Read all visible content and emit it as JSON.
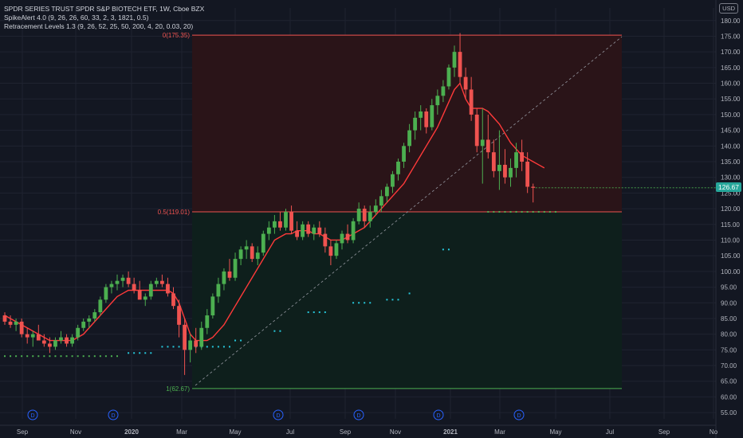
{
  "header": {
    "title": "SPDR SERIES TRUST SPDR S&P BIOTECH ETF, 1W, Cboe BZX",
    "indicator_1": "SpikeAlert 4.0 (9, 26, 26, 60, 33, 2, 3, 1821, 0.5)",
    "indicator_2": "Retracement Levels 1.3 (9, 26, 52, 25, 50, 200, 4, 20, 0.03, 20)",
    "currency": "USD"
  },
  "chart_data": {
    "type": "candlestick",
    "x_ticks": [
      "Sep",
      "Nov",
      "2020",
      "Mar",
      "May",
      "Jul",
      "Sep",
      "Nov",
      "2021",
      "Mar",
      "May",
      "Jul",
      "Sep",
      "No"
    ],
    "y_ticks": [
      55,
      60,
      65,
      70,
      75,
      80,
      85,
      90,
      95,
      100,
      105,
      110,
      115,
      120,
      125,
      130,
      135,
      140,
      145,
      150,
      155,
      160,
      165,
      170,
      175,
      180
    ],
    "ylim": [
      53,
      184
    ],
    "last_price_label": "126.67",
    "last_price": 126.67,
    "retracement": [
      {
        "label": "0(175.35)",
        "value": 175.35,
        "color": "#ef5350"
      },
      {
        "label": "0.5(119.01)",
        "value": 119.01,
        "color": "#ef5350"
      },
      {
        "label": "1(62.67)",
        "value": 62.67,
        "color": "#4caf50"
      }
    ],
    "candles": [
      [
        86,
        87,
        83,
        84
      ],
      [
        84,
        86,
        82,
        83
      ],
      [
        83,
        85,
        81,
        84
      ],
      [
        84,
        85,
        79,
        80
      ],
      [
        80,
        82,
        77,
        79
      ],
      [
        79,
        81,
        76,
        80
      ],
      [
        80,
        83,
        79,
        78
      ],
      [
        78,
        80,
        76,
        77
      ],
      [
        77,
        79,
        74,
        76
      ],
      [
        76,
        79,
        75,
        78
      ],
      [
        78,
        81,
        77,
        79
      ],
      [
        79,
        80,
        76,
        77
      ],
      [
        77,
        80,
        76,
        79
      ],
      [
        79,
        83,
        78,
        82
      ],
      [
        82,
        85,
        81,
        84
      ],
      [
        84,
        86,
        82,
        85
      ],
      [
        85,
        88,
        84,
        87
      ],
      [
        87,
        92,
        86,
        91
      ],
      [
        91,
        96,
        90,
        95
      ],
      [
        95,
        97,
        93,
        96
      ],
      [
        96,
        99,
        94,
        97
      ],
      [
        97,
        99,
        95,
        98
      ],
      [
        98,
        100,
        95,
        96
      ],
      [
        96,
        98,
        93,
        94
      ],
      [
        94,
        97,
        92,
        91
      ],
      [
        91,
        93,
        89,
        92
      ],
      [
        92,
        97,
        91,
        96
      ],
      [
        96,
        98,
        95,
        97
      ],
      [
        97,
        99,
        95,
        96
      ],
      [
        96,
        98,
        92,
        93
      ],
      [
        93,
        95,
        88,
        89
      ],
      [
        89,
        91,
        79,
        83
      ],
      [
        83,
        85,
        67,
        75
      ],
      [
        75,
        80,
        71,
        78
      ],
      [
        78,
        82,
        74,
        76
      ],
      [
        76,
        84,
        75,
        82
      ],
      [
        82,
        88,
        80,
        86
      ],
      [
        86,
        93,
        85,
        92
      ],
      [
        92,
        98,
        90,
        96
      ],
      [
        96,
        101,
        94,
        100
      ],
      [
        100,
        104,
        97,
        98
      ],
      [
        98,
        106,
        97,
        104
      ],
      [
        104,
        108,
        102,
        107
      ],
      [
        107,
        110,
        104,
        108
      ],
      [
        108,
        109,
        103,
        104
      ],
      [
        104,
        108,
        102,
        106
      ],
      [
        106,
        113,
        105,
        112
      ],
      [
        112,
        116,
        110,
        114
      ],
      [
        114,
        118,
        112,
        116
      ],
      [
        116,
        119,
        113,
        114
      ],
      [
        114,
        120,
        113,
        119
      ],
      [
        119,
        121,
        112,
        113
      ],
      [
        113,
        116,
        110,
        111
      ],
      [
        111,
        116,
        110,
        115
      ],
      [
        115,
        116,
        111,
        112
      ],
      [
        112,
        115,
        110,
        114
      ],
      [
        114,
        116,
        111,
        112
      ],
      [
        112,
        114,
        106,
        108
      ],
      [
        108,
        110,
        102,
        105
      ],
      [
        105,
        110,
        104,
        109
      ],
      [
        109,
        113,
        107,
        112
      ],
      [
        112,
        115,
        109,
        110
      ],
      [
        110,
        117,
        109,
        116
      ],
      [
        116,
        122,
        115,
        120
      ],
      [
        120,
        121,
        114,
        116
      ],
      [
        116,
        121,
        114,
        119
      ],
      [
        119,
        123,
        118,
        121
      ],
      [
        121,
        126,
        119,
        124
      ],
      [
        124,
        128,
        122,
        127
      ],
      [
        127,
        132,
        125,
        131
      ],
      [
        131,
        136,
        129,
        135
      ],
      [
        135,
        141,
        133,
        140
      ],
      [
        140,
        147,
        138,
        145
      ],
      [
        145,
        151,
        142,
        149
      ],
      [
        149,
        153,
        145,
        151
      ],
      [
        151,
        152,
        144,
        146
      ],
      [
        146,
        155,
        145,
        153
      ],
      [
        153,
        158,
        150,
        156
      ],
      [
        156,
        161,
        154,
        159
      ],
      [
        159,
        166,
        158,
        165
      ],
      [
        165,
        172,
        162,
        170
      ],
      [
        170,
        176,
        160,
        162
      ],
      [
        162,
        165,
        155,
        158
      ],
      [
        158,
        162,
        148,
        150
      ],
      [
        150,
        152,
        138,
        140
      ],
      [
        140,
        152,
        128,
        142
      ],
      [
        142,
        150,
        136,
        138
      ],
      [
        138,
        142,
        130,
        132
      ],
      [
        132,
        145,
        126,
        134
      ],
      [
        134,
        139,
        128,
        130
      ],
      [
        130,
        136,
        127,
        133
      ],
      [
        133,
        141,
        130,
        138
      ],
      [
        138,
        142,
        132,
        135
      ],
      [
        135,
        138,
        125,
        127
      ],
      [
        127,
        128,
        122,
        126.67
      ]
    ],
    "spike_alert_line": [
      86,
      85,
      84,
      83,
      82,
      81,
      80,
      79,
      78,
      78,
      78,
      78,
      78,
      79,
      80,
      82,
      84,
      86,
      88,
      90,
      92,
      93,
      94,
      94,
      94,
      94,
      94,
      94,
      94,
      94,
      93,
      90,
      85,
      80,
      78,
      78,
      78,
      79,
      81,
      83,
      86,
      89,
      92,
      95,
      98,
      101,
      104,
      107,
      110,
      111,
      112,
      112,
      113,
      113,
      113,
      112,
      112,
      111,
      110,
      110,
      110,
      111,
      112,
      113,
      114,
      116,
      118,
      120,
      122,
      124,
      126,
      128,
      131,
      134,
      137,
      140,
      143,
      146,
      150,
      154,
      158,
      160,
      155,
      152,
      152,
      152,
      151,
      149,
      147,
      144,
      141,
      139,
      137,
      136,
      135,
      134,
      133
    ],
    "dotted_support": [
      {
        "from": 0,
        "to": 20,
        "value": 73,
        "color": "#4caf50"
      },
      {
        "from": 22,
        "to": 26,
        "value": 74,
        "color": "#26c6da"
      },
      {
        "from": 28,
        "to": 34,
        "value": 76,
        "color": "#26c6da"
      },
      {
        "from": 35,
        "to": 40,
        "value": 76,
        "color": "#26c6da"
      },
      {
        "from": 41,
        "to": 42,
        "value": 78,
        "color": "#26c6da"
      },
      {
        "from": 48,
        "to": 49,
        "value": 81,
        "color": "#26c6da"
      },
      {
        "from": 54,
        "to": 57,
        "value": 87,
        "color": "#26c6da"
      },
      {
        "from": 62,
        "to": 65,
        "value": 90,
        "color": "#26c6da"
      },
      {
        "from": 68,
        "to": 70,
        "value": 91,
        "color": "#26c6da"
      },
      {
        "from": 72,
        "to": 72,
        "value": 93,
        "color": "#26c6da"
      },
      {
        "from": 78,
        "to": 79,
        "value": 107,
        "color": "#26c6da"
      },
      {
        "from": 86,
        "to": 98,
        "value": 119,
        "color": "#4caf50"
      }
    ],
    "event_markers": [
      {
        "label": "D",
        "x_index": 5
      },
      {
        "label": "D",
        "x_index": 19
      },
      {
        "label": "D",
        "x_index": 34
      },
      {
        "label": "D",
        "x_index": 48
      },
      {
        "label": "D",
        "x_index": 62
      },
      {
        "label": "D",
        "x_index": 76
      },
      {
        "label": "D",
        "x_index": 90
      }
    ]
  },
  "colors": {
    "up": "#4caf50",
    "down": "#ef5350",
    "spike_line": "#ff3a3a",
    "zone_upper": "#2a1418",
    "zone_lower": "#0e1f1c",
    "grid": "#1f2330",
    "axis_text": "#b2b5be",
    "marker": "#2962ff"
  }
}
